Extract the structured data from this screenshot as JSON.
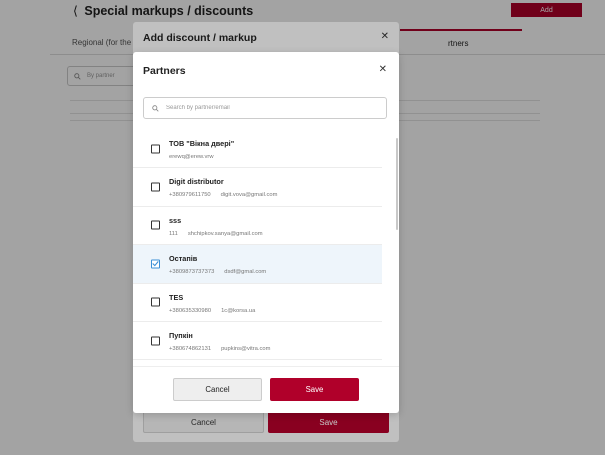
{
  "page": {
    "back_icon": "chevron-left-icon",
    "title": "Special markups / discounts",
    "add_label": "Add",
    "tabs": [
      {
        "label": "Regional (for the"
      },
      {
        "label": "rtners"
      }
    ],
    "search_placeholder": "By partner"
  },
  "outer_modal": {
    "title": "Add discount / markup",
    "close_icon": "close-icon",
    "cancel_label": "Cancel",
    "save_label": "Save"
  },
  "partners_modal": {
    "title": "Partners",
    "close_icon": "close-icon",
    "search_placeholder": "Search by partner/email",
    "cancel_label": "Cancel",
    "save_label": "Save",
    "colors": {
      "accent": "#b0002a",
      "checkbox_selected": "#3a8fd6",
      "selected_row": "#eef5fb"
    },
    "partners": [
      {
        "name": "ТОВ \"Вікна двері\"",
        "phone": "",
        "email": "erewq@erew.vrw",
        "checked": false
      },
      {
        "name": "Digit distributor",
        "phone": "+380979611750",
        "email": "digit.vova@gmail.com",
        "checked": false
      },
      {
        "name": "sss",
        "phone": "111",
        "email": "shchipkov.sanya@gmail.com",
        "checked": false
      },
      {
        "name": "Остапів",
        "phone": "+3809873737373",
        "email": "dsdf@gmal.com",
        "checked": true
      },
      {
        "name": "TES",
        "phone": "+380635330980",
        "email": "1c@korsa.ua",
        "checked": false
      },
      {
        "name": "Пупкін",
        "phone": "+380674862131",
        "email": "pupkins@vitra.com",
        "checked": false
      }
    ]
  }
}
